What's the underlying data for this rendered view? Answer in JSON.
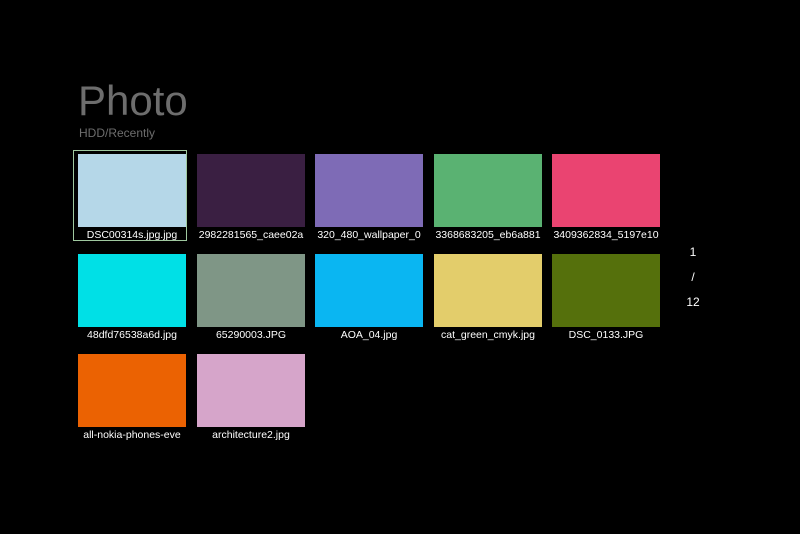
{
  "header": {
    "title": "Photo",
    "breadcrumb": "HDD/Recently"
  },
  "photos": [
    {
      "name": "DSC00314s.jpg.jpg",
      "color": "#b5d7e8",
      "selected": true
    },
    {
      "name": "2982281565_caee02a",
      "color": "#3a1f42"
    },
    {
      "name": "320_480_wallpaper_0",
      "color": "#7e6bb6"
    },
    {
      "name": "3368683205_eb6a881",
      "color": "#5ab272"
    },
    {
      "name": "3409362834_5197e10",
      "color": "#ea4471"
    },
    {
      "name": "48dfd76538a6d.jpg",
      "color": "#00e0e6"
    },
    {
      "name": "65290003.JPG",
      "color": "#7f9686"
    },
    {
      "name": "AOA_04.jpg",
      "color": "#0ab6f2"
    },
    {
      "name": "cat_green_cmyk.jpg",
      "color": "#e3cd6b"
    },
    {
      "name": "DSC_0133.JPG",
      "color": "#55700c"
    },
    {
      "name": "all-nokia-phones-eve",
      "color": "#eb6202"
    },
    {
      "name": "architecture2.jpg",
      "color": "#d6a5ca"
    }
  ],
  "pager": {
    "current": "1",
    "separator": "/",
    "total": "12"
  }
}
